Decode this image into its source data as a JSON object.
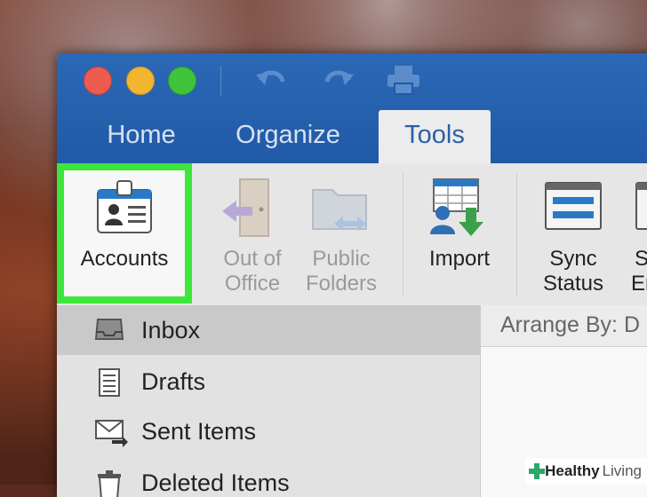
{
  "window": {
    "tabs": [
      {
        "label": "Home"
      },
      {
        "label": "Organize"
      },
      {
        "label": "Tools"
      }
    ],
    "active_tab": "Tools"
  },
  "ribbon": {
    "accounts": {
      "label": "Accounts"
    },
    "out_of_office": {
      "line1": "Out of",
      "line2": "Office"
    },
    "public_folders": {
      "line1": "Public",
      "line2": "Folders"
    },
    "import": {
      "label": "Import"
    },
    "sync_status": {
      "line1": "Sync",
      "line2": "Status"
    },
    "sync_errors": {
      "line1": "S",
      "line2": "Er"
    }
  },
  "sidebar": {
    "items": [
      {
        "label": "Inbox",
        "icon": "inbox-tray-icon"
      },
      {
        "label": "Drafts",
        "icon": "drafts-notepad-icon"
      },
      {
        "label": "Sent Items",
        "icon": "sent-envelope-icon"
      },
      {
        "label": "Deleted Items",
        "icon": "trash-icon"
      }
    ]
  },
  "content": {
    "arrange_by": "Arrange By: D"
  },
  "watermark": {
    "brand1": "Healthy",
    "brand2": "Living"
  },
  "colors": {
    "titlebar": "#215aa6",
    "highlight": "#3de63a",
    "tab_active_text": "#2a5fa8"
  }
}
